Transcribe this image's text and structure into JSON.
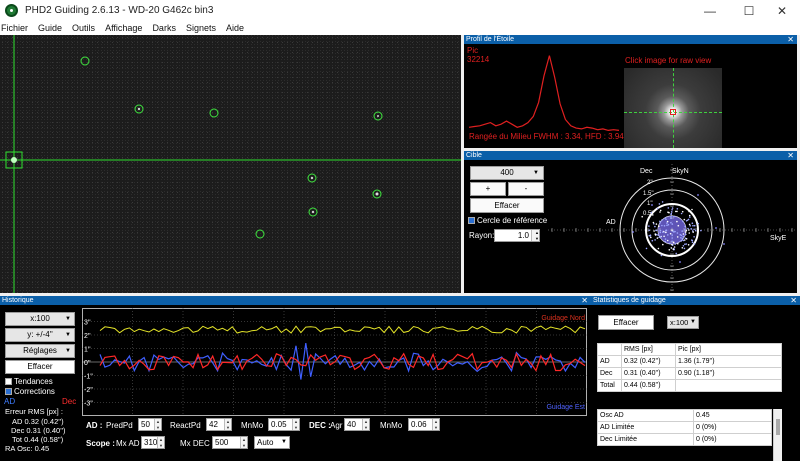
{
  "window": {
    "title": "PHD2 Guiding 2.6.13 - WD-20 G462c bin3",
    "controls": {
      "minimize": "—",
      "maximize": "☐",
      "close": "✕"
    }
  },
  "menu": [
    "Fichier",
    "Guide",
    "Outils",
    "Affichage",
    "Darks",
    "Signets",
    "Aide"
  ],
  "profile": {
    "title": "Profil de l'Étoile",
    "peak_label": "Pic",
    "peak_value": "32214",
    "fwhm_text": "Rangée du Milieu FWHM : 3.34, HFD : 3.94 (5",
    "click_hint": "Click image for raw view",
    "curve": [
      0.06,
      0.07,
      0.08,
      0.1,
      0.12,
      0.08,
      0.1,
      0.14,
      0.1,
      0.06,
      0.08,
      0.12,
      0.2,
      0.38,
      0.72,
      0.98,
      0.7,
      0.36,
      0.16,
      0.08,
      0.05,
      0.04,
      0.06,
      0.05,
      0.03,
      0.04,
      0.02,
      0.03,
      0.02
    ]
  },
  "target": {
    "title": "Cible",
    "scale_value": "400",
    "plus": "+",
    "minus": "-",
    "clear": "Effacer",
    "reference_circle": "Cercle de référence",
    "radius_label": "Rayon:",
    "radius_value": "1.0",
    "axis_labels": {
      "dec": "Dec",
      "skyn": "SkyN",
      "ad": "AD",
      "skye": "SkyE"
    },
    "ring_labels": [
      "2''",
      "1.5''",
      "1''",
      "0.5''"
    ]
  },
  "history": {
    "title": "Historique",
    "x_scale": "x:100",
    "y_scale": "y: +/-4''",
    "settings": "Réglages",
    "clear": "Effacer",
    "trends": "Tendances",
    "corrections": "Corrections",
    "legend_ad": "AD",
    "legend_dec": "Dec",
    "rms_header": "Erreur RMS [px] :",
    "rms_ad": "AD 0.32 (0.42'')",
    "rms_dec": "Dec 0.31 (0.40'')",
    "rms_tot": "Tot 0.44 (0.58'')",
    "ra_osc": "RA Osc: 0.45",
    "guide_north": "Guidage Nord",
    "guide_east": "Guidage Est",
    "y_ticks": [
      "3''",
      "2''",
      "1''",
      "0''",
      "-1''",
      "-2''",
      "-3''"
    ],
    "ad_row": {
      "label": "AD :",
      "predpd_label": "PredPd",
      "predpd": "50",
      "reactpd_label": "ReactPd",
      "reactpd": "42",
      "mnmo_label": "MnMo",
      "mnmo": "0.05"
    },
    "dec_row": {
      "label": "DEC :",
      "agr_label": "Agr",
      "agr": "40",
      "mnmo_label": "MnMo",
      "mnmo": "0.06"
    },
    "scope_row": {
      "label": "Scope :",
      "mxad_label": "Mx AD",
      "mxad": "310",
      "mxdec_label": "Mx DEC",
      "mxdec": "500",
      "mode": "Auto"
    }
  },
  "stats": {
    "title": "Statistiques de guidage",
    "clear": "Effacer",
    "scale": "x:100",
    "headers": [
      "",
      "RMS [px]",
      "Pic [px]"
    ],
    "rows": [
      [
        "AD",
        "0.32 (0.42'')",
        "1.36 (1.79'')"
      ],
      [
        "Dec",
        "0.31 (0.40'')",
        "0.90 (1.18'')"
      ],
      [
        "Total",
        "0.44 (0.58'')",
        ""
      ]
    ],
    "osc_rows": [
      [
        "Osc AD",
        "0.45"
      ],
      [
        "AD Limitée",
        "0 (0%)"
      ],
      [
        "Dec Limitée",
        "0 (0%)"
      ]
    ]
  }
}
